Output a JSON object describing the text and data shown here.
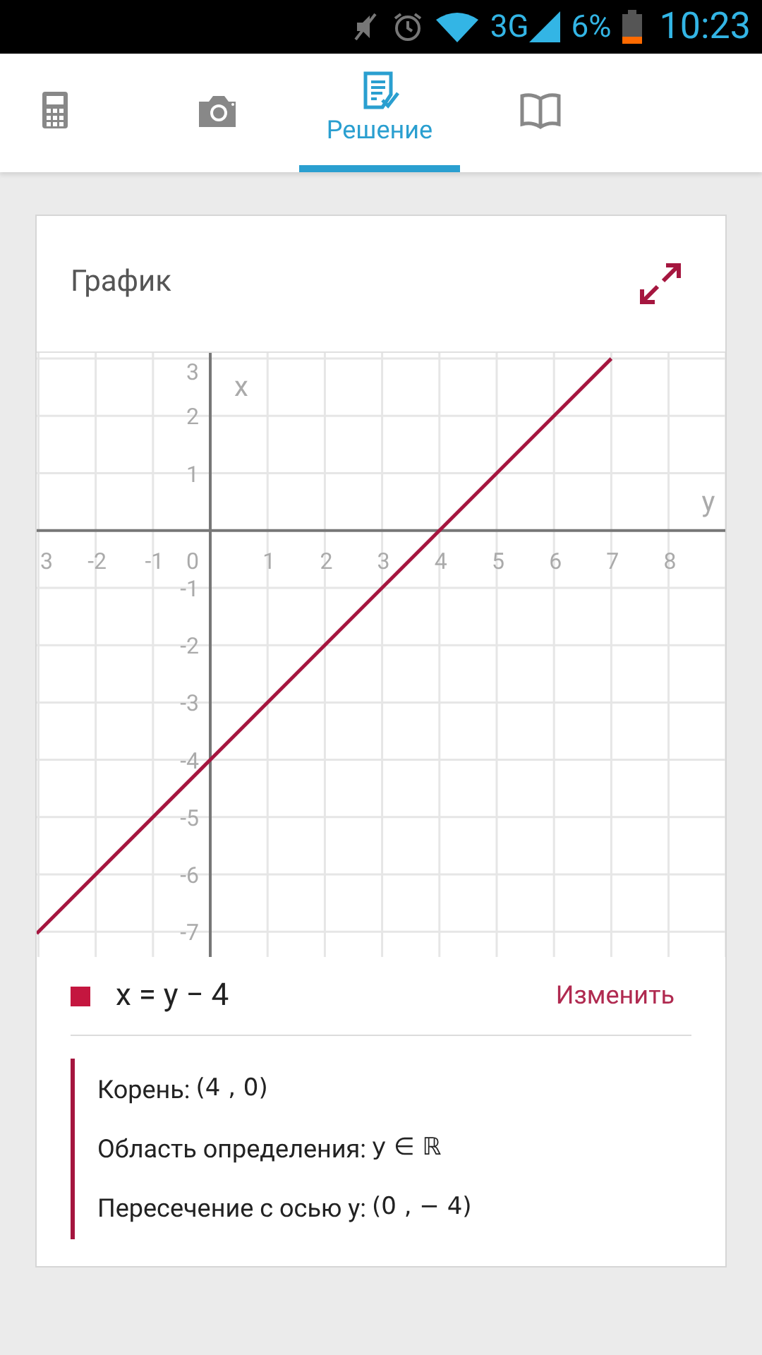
{
  "status_bar": {
    "network": "3G",
    "battery": "6%",
    "time": "10:23"
  },
  "tabs": [
    {
      "kind": "calculator",
      "selected": false
    },
    {
      "kind": "camera",
      "selected": false
    },
    {
      "kind": "solution",
      "label": "Решение",
      "selected": true
    },
    {
      "kind": "book",
      "selected": false
    }
  ],
  "graph_card": {
    "title": "График",
    "chart_data": {
      "type": "line",
      "grid": true,
      "xlabel": "y",
      "ylabel": "x",
      "xlim": [
        -3.03,
        9.04
      ],
      "ylim": [
        -7.44,
        3.1
      ],
      "xticks": [
        {
          "value": -3,
          "label": "3"
        },
        -2,
        -1,
        1,
        2,
        3,
        4,
        5,
        6,
        7,
        8
      ],
      "yticks": [
        -7,
        -6,
        -5,
        -4,
        -3,
        -2,
        -1,
        1,
        2,
        {
          "value": 3,
          "label": "3"
        }
      ],
      "x": [
        -3.03,
        7
      ],
      "series": [
        {
          "name": "x = y − 4",
          "color": "#a5163f",
          "values": [
            -7.03,
            3
          ]
        }
      ]
    },
    "origin_label": "0",
    "legend": {
      "color": "#c4163f",
      "edit": "Изменить"
    },
    "properties": [
      {
        "label": "Корень:",
        "value": "(4 , 0)"
      },
      {
        "label": "Область определения:",
        "value": "y ∈ ℝ"
      },
      {
        "label": "Пересечение с осью y:",
        "value": "(0 , − 4)"
      }
    ]
  }
}
